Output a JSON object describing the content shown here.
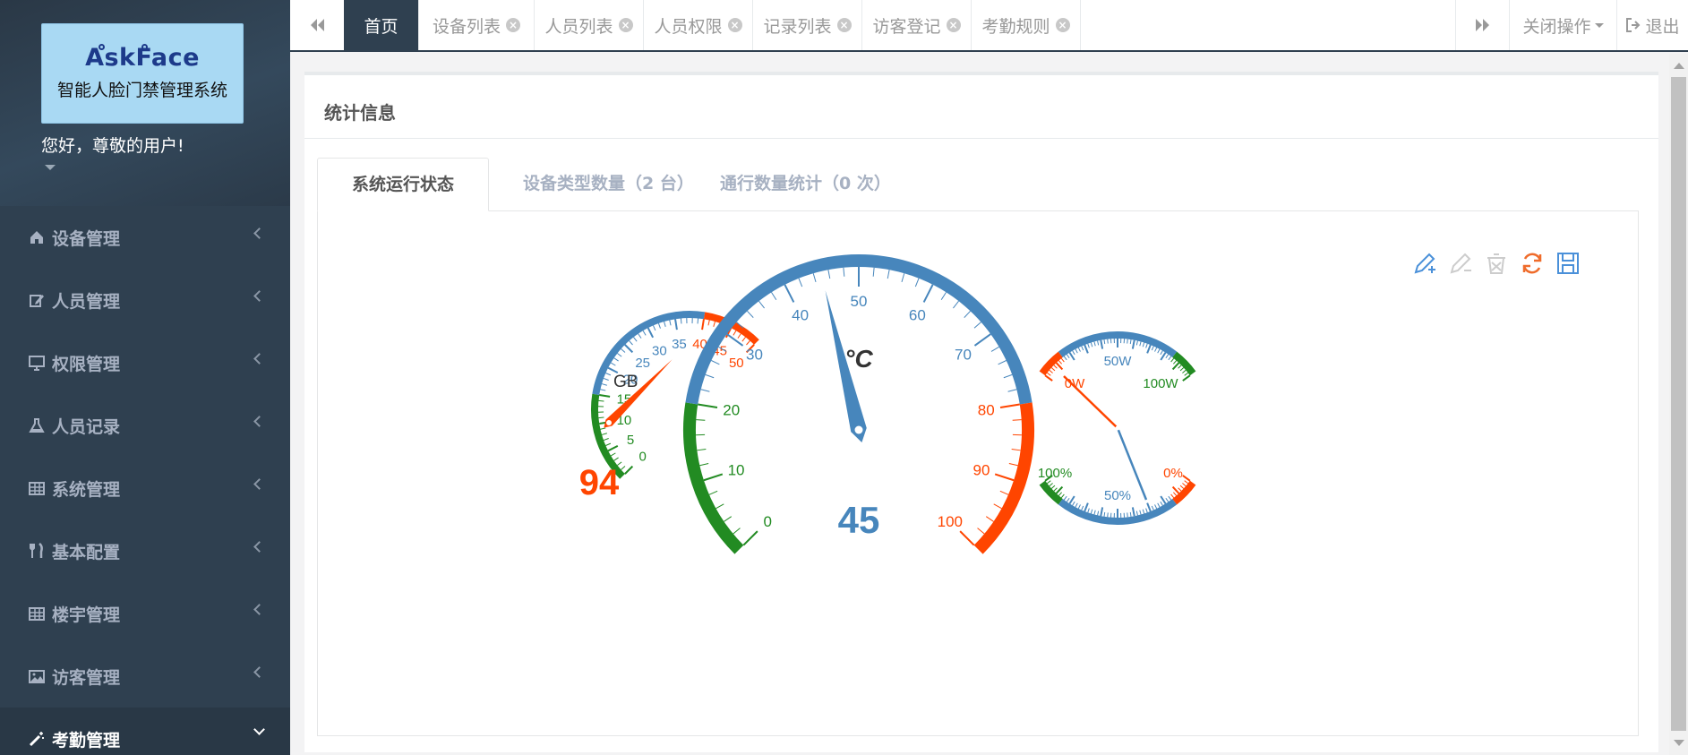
{
  "brand": {
    "title": "AskFace",
    "subtitle": "智能人脸门禁管理系统"
  },
  "user": {
    "greeting": "您好，尊敬的用户!"
  },
  "menu": [
    {
      "label": "设备管理",
      "icon": "home-icon"
    },
    {
      "label": "人员管理",
      "icon": "edit-icon"
    },
    {
      "label": "权限管理",
      "icon": "desktop-icon"
    },
    {
      "label": "人员记录",
      "icon": "flask-icon"
    },
    {
      "label": "系统管理",
      "icon": "table-icon"
    },
    {
      "label": "基本配置",
      "icon": "cutlery-icon"
    },
    {
      "label": "楼宇管理",
      "icon": "table-icon"
    },
    {
      "label": "访客管理",
      "icon": "picture-icon"
    },
    {
      "label": "考勤管理",
      "icon": "magic-icon"
    }
  ],
  "topbar": {
    "tabs": [
      {
        "label": "首页"
      },
      {
        "label": "设备列表"
      },
      {
        "label": "人员列表"
      },
      {
        "label": "人员权限"
      },
      {
        "label": "记录列表"
      },
      {
        "label": "访客登记"
      },
      {
        "label": "考勤规则"
      }
    ],
    "close_ops": "关闭操作",
    "logout": "退出"
  },
  "panel": {
    "title": "统计信息",
    "tabs": [
      {
        "label": "系统运行状态"
      },
      {
        "label": "设备类型数量（2 台）"
      },
      {
        "label": "通行数量统计（0 次）"
      }
    ]
  },
  "toolbox": [
    "pencil-plus-icon",
    "pencil-minus-icon",
    "clear-icon",
    "refresh-icon",
    "save-icon"
  ],
  "colors": {
    "blue": "#4786bc",
    "green": "#228b22",
    "red": "#ff4500",
    "sidebar": "#2f4050"
  },
  "chart_data": [
    {
      "type": "gauge",
      "min": 0,
      "max": 50,
      "value": 94,
      "unit": "GB",
      "ticks": [
        "0",
        "5",
        "10",
        "15",
        "20",
        "25",
        "30",
        "35",
        "40",
        "45",
        "50"
      ],
      "value_label": "94"
    },
    {
      "type": "gauge",
      "min": 0,
      "max": 100,
      "value": 45,
      "unit": "°C",
      "ticks": [
        "0",
        "10",
        "20",
        "30",
        "40",
        "50",
        "60",
        "70",
        "80",
        "90",
        "100"
      ],
      "value_label": "45"
    },
    {
      "type": "dual-gauge",
      "top": {
        "labels": [
          "0W",
          "50W",
          "100W"
        ],
        "pointer": 0
      },
      "bottom": {
        "labels": [
          "100%",
          "50%",
          "0%"
        ],
        "pointer": 0.06
      }
    }
  ]
}
